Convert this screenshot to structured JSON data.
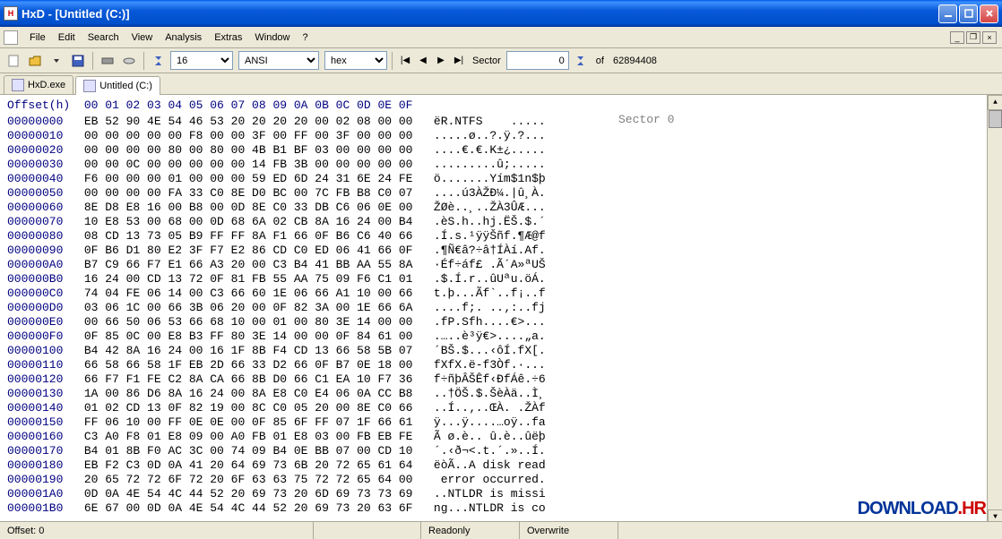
{
  "title": "HxD - [Untitled (C:)]",
  "menus": [
    "File",
    "Edit",
    "Search",
    "View",
    "Analysis",
    "Extras",
    "Window",
    "?"
  ],
  "toolbar": {
    "bytes_per_row": "16",
    "encoding": "ANSI",
    "base": "hex",
    "sector_label": "Sector",
    "sector_value": "0",
    "of_label": "of",
    "total_sectors": "62894408"
  },
  "tabs": [
    {
      "label": "HxD.exe",
      "active": false
    },
    {
      "label": "Untitled (C:)",
      "active": true
    }
  ],
  "hex": {
    "header_label": "Offset(h)",
    "header_cols": "00 01 02 03 04 05 06 07 08 09 0A 0B 0C 0D 0E 0F",
    "annotation": "Sector 0",
    "rows": [
      {
        "o": "00000000",
        "b": "EB 52 90 4E 54 46 53 20 20 20 20 00 02 08 00 00",
        "a": "ëR.NTFS    ....."
      },
      {
        "o": "00000010",
        "b": "00 00 00 00 00 F8 00 00 3F 00 FF 00 3F 00 00 00",
        "a": ".....ø..?.ÿ.?..."
      },
      {
        "o": "00000020",
        "b": "00 00 00 00 80 00 80 00 4B B1 BF 03 00 00 00 00",
        "a": "....€.€.K±¿....."
      },
      {
        "o": "00000030",
        "b": "00 00 0C 00 00 00 00 00 14 FB 3B 00 00 00 00 00",
        "a": ".........û;....."
      },
      {
        "o": "00000040",
        "b": "F6 00 00 00 01 00 00 00 59 ED 6D 24 31 6E 24 FE",
        "a": "ö.......Yím$1n$þ"
      },
      {
        "o": "00000050",
        "b": "00 00 00 00 FA 33 C0 8E D0 BC 00 7C FB B8 C0 07",
        "a": "....ú3ÀŽÐ¼.|û¸À."
      },
      {
        "o": "00000060",
        "b": "8E D8 E8 16 00 B8 00 0D 8E C0 33 DB C6 06 0E 00",
        "a": "ŽØè..¸..ŽÀ3ÛÆ..."
      },
      {
        "o": "00000070",
        "b": "10 E8 53 00 68 00 0D 68 6A 02 CB 8A 16 24 00 B4",
        "a": ".èS.h..hj.ËŠ.$.´"
      },
      {
        "o": "00000080",
        "b": "08 CD 13 73 05 B9 FF FF 8A F1 66 0F B6 C6 40 66",
        "a": ".Í.s.¹ÿÿŠñf.¶Æ@f"
      },
      {
        "o": "00000090",
        "b": "0F B6 D1 80 E2 3F F7 E2 86 CD C0 ED 06 41 66 0F",
        "a": ".¶Ñ€â?÷â†ÍÀí.Af."
      },
      {
        "o": "000000A0",
        "b": "B7 C9 66 F7 E1 66 A3 20 00 C3 B4 41 BB AA 55 8A",
        "a": "·Éf÷áf£ .Ã´A»ªUŠ"
      },
      {
        "o": "000000B0",
        "b": "16 24 00 CD 13 72 0F 81 FB 55 AA 75 09 F6 C1 01",
        "a": ".$.Í.r..ûUªu.öÁ."
      },
      {
        "o": "000000C0",
        "b": "74 04 FE 06 14 00 C3 66 60 1E 06 66 A1 10 00 66",
        "a": "t.þ...Ãf`..f¡..f"
      },
      {
        "o": "000000D0",
        "b": "03 06 1C 00 66 3B 06 20 00 0F 82 3A 00 1E 66 6A",
        "a": "....f;. ..‚:..fj"
      },
      {
        "o": "000000E0",
        "b": "00 66 50 06 53 66 68 10 00 01 00 80 3E 14 00 00",
        "a": ".fP.Sfh....€>..."
      },
      {
        "o": "000000F0",
        "b": "0F 85 0C 00 E8 B3 FF 80 3E 14 00 00 0F 84 61 00",
        "a": ".…..è³ÿ€>....„a."
      },
      {
        "o": "00000100",
        "b": "B4 42 8A 16 24 00 16 1F 8B F4 CD 13 66 58 5B 07",
        "a": "´BŠ.$...‹ôÍ.fX[."
      },
      {
        "o": "00000110",
        "b": "66 58 66 58 1F EB 2D 66 33 D2 66 0F B7 0E 18 00",
        "a": "fXfX.ë-f3Òf.·..."
      },
      {
        "o": "00000120",
        "b": "66 F7 F1 FE C2 8A CA 66 8B D0 66 C1 EA 10 F7 36",
        "a": "f÷ñþÂŠÊf‹ÐfÁê.÷6"
      },
      {
        "o": "00000130",
        "b": "1A 00 86 D6 8A 16 24 00 8A E8 C0 E4 06 0A CC B8",
        "a": "..†ÖŠ.$.ŠèÀä..Ì¸"
      },
      {
        "o": "00000140",
        "b": "01 02 CD 13 0F 82 19 00 8C C0 05 20 00 8E C0 66",
        "a": "..Í..‚..ŒÀ. .ŽÀf"
      },
      {
        "o": "00000150",
        "b": "FF 06 10 00 FF 0E 0E 00 0F 85 6F FF 07 1F 66 61",
        "a": "ÿ...ÿ....…oÿ..fa"
      },
      {
        "o": "00000160",
        "b": "C3 A0 F8 01 E8 09 00 A0 FB 01 E8 03 00 FB EB FE",
        "a": "Ã ø.è.. û.è..ûëþ"
      },
      {
        "o": "00000170",
        "b": "B4 01 8B F0 AC 3C 00 74 09 B4 0E BB 07 00 CD 10",
        "a": "´.‹ð¬<.t.´.»..Í."
      },
      {
        "o": "00000180",
        "b": "EB F2 C3 0D 0A 41 20 64 69 73 6B 20 72 65 61 64",
        "a": "ëòÃ..A disk read"
      },
      {
        "o": "00000190",
        "b": "20 65 72 72 6F 72 20 6F 63 63 75 72 72 65 64 00",
        "a": " error occurred."
      },
      {
        "o": "000001A0",
        "b": "0D 0A 4E 54 4C 44 52 20 69 73 20 6D 69 73 73 69",
        "a": "..NTLDR is missi"
      },
      {
        "o": "000001B0",
        "b": "6E 67 00 0D 0A 4E 54 4C 44 52 20 69 73 20 63 6F",
        "a": "ng...NTLDR is co"
      }
    ]
  },
  "status": {
    "offset_label": "Offset:",
    "offset_value": "0",
    "readonly": "Readonly",
    "overwrite": "Overwrite"
  },
  "watermark": {
    "part1": "DOWNLOAD",
    "part2": ".HR"
  }
}
